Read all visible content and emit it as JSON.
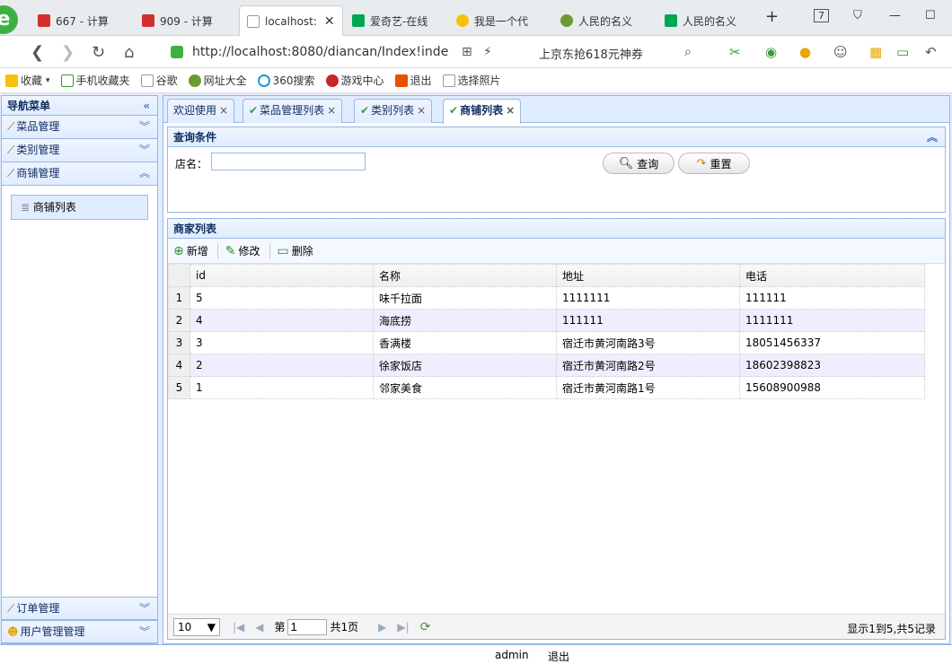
{
  "browser": {
    "tabs": [
      {
        "label": "667 - 计算",
        "active": false
      },
      {
        "label": "909 - 计算",
        "active": false
      },
      {
        "label": "localhost:",
        "active": true
      },
      {
        "label": "爱奇艺-在线",
        "active": false
      },
      {
        "label": "我是一个代",
        "active": false
      },
      {
        "label": "人民的名义",
        "active": false
      },
      {
        "label": "人民的名义",
        "active": false
      }
    ],
    "new_tab": "+",
    "tab_count": "7",
    "url": "http://localhost:8080/diancan/Index!inde",
    "promo": "上京东抢618元神券",
    "bookmarks": [
      "收藏",
      "手机收藏夹",
      "谷歌",
      "网址大全",
      "360搜索",
      "游戏中心",
      "退出",
      "选择照片"
    ]
  },
  "sidebar": {
    "title": "导航菜单",
    "sections": [
      {
        "label": "菜品管理"
      },
      {
        "label": "类别管理"
      },
      {
        "label": "商铺管理"
      }
    ],
    "expanded_item": "商铺列表",
    "bottom_sections": [
      {
        "label": "订单管理"
      },
      {
        "label": "用户管理管理"
      }
    ]
  },
  "content_tabs": [
    {
      "label": "欢迎使用",
      "active": false,
      "icon": false
    },
    {
      "label": "菜品管理列表",
      "active": false,
      "icon": true
    },
    {
      "label": "类别列表",
      "active": false,
      "icon": true
    },
    {
      "label": "商铺列表",
      "active": true,
      "icon": true
    }
  ],
  "query": {
    "title": "查询条件",
    "shopname_label": "店名：",
    "shopname_value": "",
    "search_label": "查询",
    "reset_label": "重置"
  },
  "grid": {
    "title": "商家列表",
    "toolbar": {
      "add": "新增",
      "edit": "修改",
      "delete": "删除"
    },
    "columns": [
      "id",
      "名称",
      "地址",
      "电话"
    ],
    "rows": [
      {
        "n": "1",
        "id": "5",
        "name": "味千拉面",
        "addr": "1111111",
        "tel": "111111"
      },
      {
        "n": "2",
        "id": "4",
        "name": "海底捞",
        "addr": "111111",
        "tel": "1111111"
      },
      {
        "n": "3",
        "id": "3",
        "name": "香满楼",
        "addr": "宿迁市黄河南路3号",
        "tel": "18051456337"
      },
      {
        "n": "4",
        "id": "2",
        "name": "徐家饭店",
        "addr": "宿迁市黄河南路2号",
        "tel": "18602398823"
      },
      {
        "n": "5",
        "id": "1",
        "name": "邻家美食",
        "addr": "宿迁市黄河南路1号",
        "tel": "15608900988"
      }
    ],
    "pager": {
      "page_size": "10",
      "page_prefix": "第",
      "page_value": "1",
      "page_total": "共1页",
      "info": "显示1到5,共5记录"
    }
  },
  "footer": {
    "user": "admin",
    "logout": "退出"
  }
}
